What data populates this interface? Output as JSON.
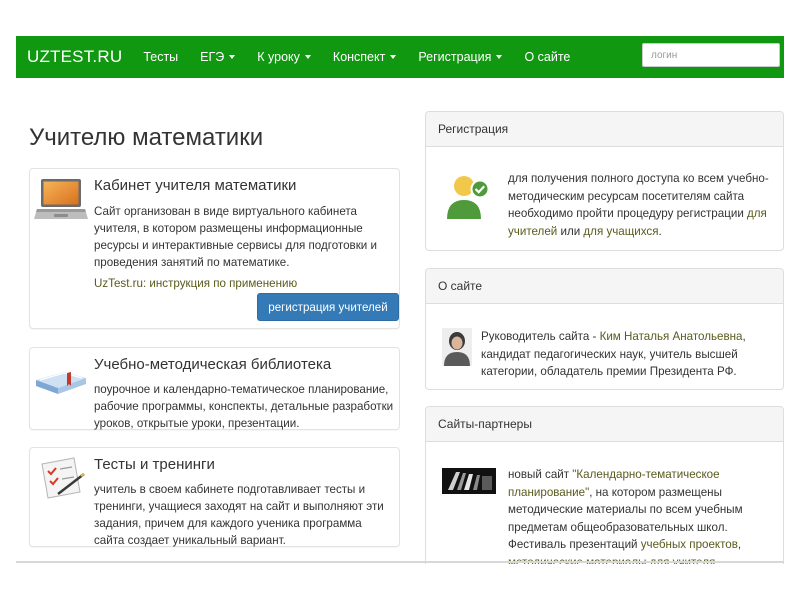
{
  "navbar": {
    "brand": "UZTEST.RU",
    "items": [
      {
        "label": "Тесты"
      },
      {
        "label": "ЕГЭ"
      },
      {
        "label": "К уроку"
      },
      {
        "label": "Конспект"
      },
      {
        "label": "Регистрация"
      },
      {
        "label": "О сайте"
      }
    ],
    "login_placeholder": "логин",
    "color": "#119811"
  },
  "main": {
    "title": "Учителю математики",
    "cards": [
      {
        "title": "Кабинет учителя математики",
        "text": "Сайт организован в виде виртуального кабинета учителя, в котором размещены информационные ресурсы и интерактивные сервисы для подготовки и проведения занятий по математике.",
        "instruction_link": "UzTest.ru: инструкция по применению",
        "button_label": "регистрация учителей",
        "icon": "laptop-icon"
      },
      {
        "title": "Учебно-методическая библиотека",
        "text": "поурочное и календарно-тематическое планирование, рабочие программы, конспекты, детальные разработки уроков, открытые уроки, презентации.",
        "icon": "book-icon"
      },
      {
        "title": "Тесты и тренинги",
        "text": "учитель в своем кабинете подготавливает тесты и тренинги, учащиеся заходят на сайт и выполняют эти задания, причем для каждого ученика программа сайта создает уникальный вариант.",
        "icon": "checklist-icon"
      }
    ]
  },
  "sidebar": {
    "registration": {
      "heading": "Регистрация",
      "text_before": "для получения полного доступа ко всем учебно-методическим ресурсам посетителям сайта необходимо пройти процедуру регистрации ",
      "link1": "для учителей",
      "middle": " или ",
      "link2": "для учащихся",
      "text_after": ".",
      "icon": "user-check-icon"
    },
    "about": {
      "heading": "О сайте",
      "text_before": "Руководитель сайта - ",
      "link": "Ким Наталья Анатольевна",
      "text_after": ", кандидат педагогических наук, учитель высшей категории, обладатель премии Президента РФ.",
      "icon": "portrait-photo"
    },
    "partners": {
      "heading": "Сайты-партнеры",
      "text_before": "новый сайт ",
      "link1": "\"Календарно-тематическое планирование\"",
      "middle1": ", на котором размещены методические материалы по всем учебным предметам общеобразовательных школ. Фестиваль презентаций ",
      "link2": "учебных проектов",
      "middle2": ", ",
      "link3": "методические материалы для учителя",
      "icon": "books-thumbnail"
    }
  }
}
